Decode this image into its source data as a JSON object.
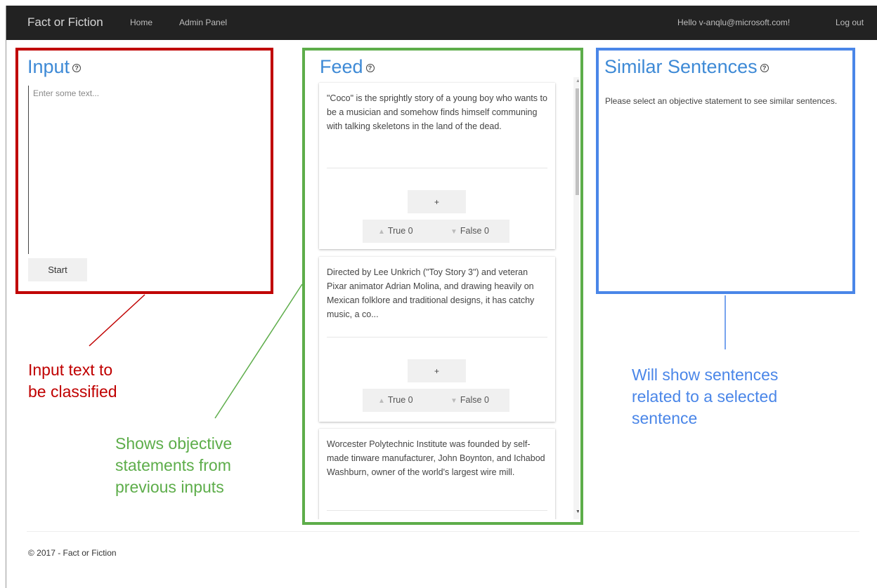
{
  "nav": {
    "brand": "Fact or Fiction",
    "home": "Home",
    "admin": "Admin Panel",
    "greeting": "Hello v-anqlu@microsoft.com!",
    "logout": "Log out"
  },
  "input_panel": {
    "title": "Input",
    "help_icon": "question-circle-icon",
    "placeholder": "Enter some text...",
    "start_label": "Start"
  },
  "feed_panel": {
    "title": "Feed",
    "help_icon": "question-circle-icon",
    "cards": [
      {
        "text": "\"Coco\" is the sprightly story of a young boy who wants to be a musician and somehow finds himself communing with talking skeletons in the land of the dead.",
        "plus": "+",
        "true_label": "True 0",
        "false_label": "False 0"
      },
      {
        "text": "Directed by Lee Unkrich (\"Toy Story 3\") and veteran Pixar animator Adrian Molina, and drawing heavily on Mexican folklore and traditional designs, it has catchy music, a co...",
        "plus": "+",
        "true_label": "True 0",
        "false_label": "False 0"
      },
      {
        "text": "Worcester Polytechnic Institute was founded by self-made tinware manufacturer, John Boynton, and Ichabod Washburn, owner of the world's largest wire mill."
      }
    ],
    "arrow_up_icon": "triangle-up-icon",
    "arrow_down_icon": "triangle-down-icon"
  },
  "similar_panel": {
    "title": "Similar Sentences",
    "help_icon": "question-circle-icon",
    "message": "Please select an objective statement to see similar sentences."
  },
  "annotations": {
    "input": [
      "Input text to",
      "be classified"
    ],
    "feed": [
      "Shows objective",
      "statements from",
      "previous inputs"
    ],
    "similar": [
      "Will show sentences",
      "related to a selected",
      "sentence"
    ]
  },
  "colors": {
    "input_border": "#c00000",
    "feed_border": "#5dad4a",
    "similar_border": "#4a86e8",
    "title_blue": "#3e8ad6",
    "navbar": "#222222"
  },
  "footer": {
    "text": "© 2017 - Fact or Fiction"
  }
}
